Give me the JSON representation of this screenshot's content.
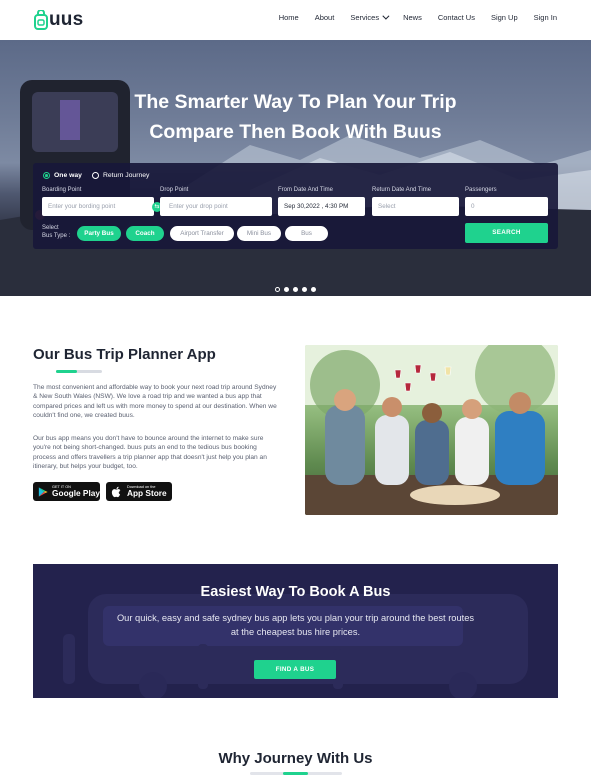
{
  "brand": {
    "logo_text": "uus",
    "accent_color": "#1fd28e",
    "dark_color": "#23224d"
  },
  "nav": {
    "items": [
      "Home",
      "About",
      "Services",
      "News",
      "Contact Us",
      "Sign Up",
      "Sign In"
    ]
  },
  "hero": {
    "title_line1": "The Smarter Way To Plan Your Trip",
    "title_line2": "Compare Then Book With Buus"
  },
  "search": {
    "trip_options": [
      "One way",
      "Return Journey"
    ],
    "selected_trip": "One way",
    "fields": {
      "boarding": {
        "label": "Boarding Point",
        "placeholder": "Enter your bording point"
      },
      "drop": {
        "label": "Drop Point",
        "placeholder": "Enter your drop point"
      },
      "from": {
        "label": "From Date And Time",
        "value": "Sep 30,2022 , 4:30 PM"
      },
      "return": {
        "label": "Return Date And Time",
        "placeholder": "Select"
      },
      "passengers": {
        "label": "Passengers",
        "value": "0"
      }
    },
    "bus_type_label_1": "Select",
    "bus_type_label_2": "Bus Type :",
    "bus_types": [
      "Party Bus",
      "Coach",
      "Airport Transfer",
      "Mini Bus",
      "Bus"
    ],
    "selected_bus_types": [
      "Party Bus",
      "Coach"
    ],
    "search_label": "SEARCH"
  },
  "slider": {
    "total": 5,
    "current": 1
  },
  "app": {
    "title": "Our Bus Trip Planner App",
    "para1": "The most convenient and affordable way to book your next road trip around Sydney & New South Wales (NSW). We love a road trip and we wanted a bus app that compared prices and left us with more money to spend at our destination. When we couldn't find one, we created buus.",
    "para2": "Our bus app means you don't have to bounce around the internet to make sure you're not being short-changed. buus puts an end to the tedious bus booking process and offers travellers a trip planner app that doesn't just help you plan an itinerary, but helps your budget, too.",
    "google_small": "GET IT ON",
    "google_big": "Google Play",
    "apple_small": "Download on the",
    "apple_big": "App Store"
  },
  "cta": {
    "title": "Easiest Way To Book A Bus",
    "text_line1": "Our quick, easy and safe sydney bus app lets you plan your trip around the best routes",
    "text_line2": "at the cheapest bus hire prices.",
    "button": "FIND A BUS"
  },
  "why": {
    "title": "Why Journey  With Us"
  }
}
